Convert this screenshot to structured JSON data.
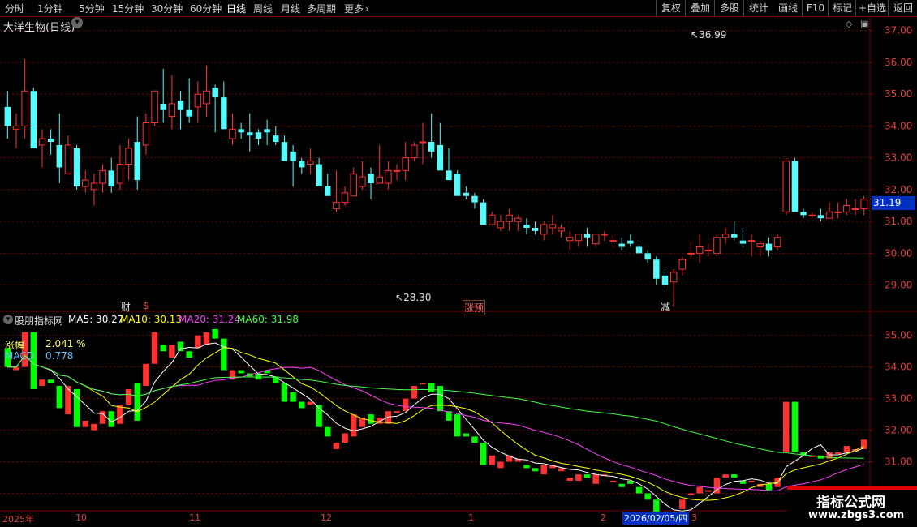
{
  "toolbar": {
    "periods": [
      {
        "label": "分时",
        "active": false
      },
      {
        "label": "1分钟",
        "active": false
      },
      {
        "label": "5分钟",
        "active": false
      },
      {
        "label": "15分钟",
        "active": false
      },
      {
        "label": "30分钟",
        "active": false
      },
      {
        "label": "60分钟",
        "active": false
      },
      {
        "label": "日线",
        "active": true
      },
      {
        "label": "周线",
        "active": false
      },
      {
        "label": "月线",
        "active": false
      },
      {
        "label": "多周期",
        "active": false
      },
      {
        "label": "更多",
        "active": false
      }
    ],
    "right_buttons": [
      "复权",
      "叠加",
      "多股",
      "统计",
      "画线",
      "F10",
      "+自选",
      "返回"
    ],
    "more_icon": "chevron-right-icon"
  },
  "main_chart": {
    "title": "大洋生物(日线)",
    "current_price_badge": "31.19",
    "high_annotation": "36.99",
    "low_annotation": "28.30",
    "event_markers": [
      {
        "label": "财",
        "color": "#e0e0e0"
      },
      {
        "label": "$",
        "color": "#e04040"
      },
      {
        "label": "涨预",
        "color": "#ff6060"
      },
      {
        "label": "减",
        "color": "#e0e0e0"
      }
    ]
  },
  "indicator": {
    "name": "股朋指标网",
    "ma5_label": "MA5: 30.27",
    "ma10_label": "MA10: 30.13",
    "ma20_label": "MA20: 31.24",
    "ma60_label": "MA60: 31.98",
    "zhangfu_label": "涨幅",
    "zhangfu_value": "2.041 %",
    "macd_label": "MACD",
    "macd_value": "0.778"
  },
  "time_axis": {
    "labels": [
      "2025年",
      "10",
      "11",
      "12",
      "1",
      "2",
      "3"
    ],
    "cursor_date": "2026/02/05/四"
  },
  "watermark": {
    "title": "指标公式网",
    "url": "www.zbgs3.com"
  },
  "colors": {
    "up": "#ff3232",
    "down": "#54fcfc",
    "down_lower": "#00ff00",
    "grid": "#7a0000",
    "ma5": "#ffffff",
    "ma10": "#ffff00",
    "ma20": "#ff40ff",
    "ma60": "#40ff40"
  },
  "chart_data": {
    "type": "candlestick",
    "y_axis_main": {
      "min": 29,
      "max": 37,
      "ticks": [
        "37.00",
        "36.00",
        "35.00",
        "34.00",
        "33.00",
        "32.00",
        "31.00",
        "30.00",
        "29.00"
      ]
    },
    "y_axis_lower": {
      "min": 30,
      "max": 35,
      "ticks": [
        "35.00",
        "34.00",
        "33.00",
        "32.00",
        "31.00",
        "30.00"
      ]
    },
    "ohlc": [
      [
        34.6,
        35.1,
        33.6,
        34.0
      ],
      [
        33.9,
        34.4,
        33.3,
        34.0
      ],
      [
        34.0,
        36.1,
        33.6,
        35.1
      ],
      [
        35.1,
        35.2,
        33.3,
        33.3
      ],
      [
        33.4,
        33.9,
        32.7,
        33.6
      ],
      [
        33.6,
        33.9,
        33.1,
        33.5
      ],
      [
        33.4,
        34.4,
        32.2,
        32.7
      ],
      [
        32.5,
        33.7,
        32.5,
        33.4
      ],
      [
        33.3,
        33.4,
        32.0,
        32.1
      ],
      [
        32.1,
        32.6,
        31.9,
        32.3
      ],
      [
        32.0,
        32.5,
        31.5,
        32.2
      ],
      [
        32.2,
        32.8,
        31.9,
        32.6
      ],
      [
        32.6,
        33.0,
        31.9,
        32.1
      ],
      [
        32.2,
        33.4,
        32.0,
        32.8
      ],
      [
        32.8,
        33.6,
        32.3,
        33.3
      ],
      [
        33.5,
        34.3,
        32.0,
        32.3
      ],
      [
        33.4,
        34.4,
        33.1,
        34.1
      ],
      [
        34.1,
        35.1,
        34.0,
        35.1
      ],
      [
        34.7,
        35.8,
        34.1,
        34.5
      ],
      [
        34.3,
        35.6,
        33.9,
        34.7
      ],
      [
        34.8,
        35.1,
        33.9,
        34.5
      ],
      [
        34.5,
        35.5,
        34.1,
        34.3
      ],
      [
        34.6,
        35.4,
        34.1,
        35.0
      ],
      [
        34.7,
        35.9,
        34.3,
        35.1
      ],
      [
        35.2,
        35.3,
        33.8,
        34.9
      ],
      [
        34.9,
        35.4,
        33.9,
        33.9
      ],
      [
        33.6,
        34.4,
        33.4,
        33.9
      ],
      [
        33.9,
        34.1,
        33.6,
        33.8
      ],
      [
        33.8,
        34.4,
        33.2,
        33.7
      ],
      [
        33.8,
        33.9,
        33.4,
        33.6
      ],
      [
        33.9,
        34.2,
        33.4,
        33.8
      ],
      [
        33.7,
        34.0,
        33.4,
        33.5
      ],
      [
        33.5,
        33.7,
        32.9,
        32.9
      ],
      [
        33.2,
        33.4,
        32.1,
        32.9
      ],
      [
        32.9,
        33.0,
        32.5,
        32.7
      ],
      [
        32.8,
        33.3,
        32.5,
        32.9
      ],
      [
        32.8,
        33.0,
        32.1,
        32.1
      ],
      [
        32.1,
        32.5,
        31.8,
        31.8
      ],
      [
        31.4,
        32.6,
        31.3,
        31.6
      ],
      [
        31.6,
        32.1,
        31.5,
        31.9
      ],
      [
        31.8,
        32.7,
        31.8,
        32.5
      ],
      [
        32.1,
        32.9,
        32.0,
        32.4
      ],
      [
        32.5,
        32.7,
        31.7,
        32.2
      ],
      [
        32.2,
        33.4,
        32.2,
        32.4
      ],
      [
        32.2,
        32.9,
        32.0,
        32.6
      ],
      [
        32.6,
        32.8,
        32.3,
        32.6
      ],
      [
        32.6,
        33.5,
        32.3,
        33.0
      ],
      [
        33.0,
        33.5,
        32.9,
        33.4
      ],
      [
        33.5,
        34.1,
        32.8,
        33.5
      ],
      [
        33.5,
        34.4,
        33.0,
        33.2
      ],
      [
        33.4,
        34.1,
        32.7,
        32.6
      ],
      [
        32.6,
        33.3,
        32.3,
        32.3
      ],
      [
        32.5,
        32.6,
        31.9,
        31.8
      ],
      [
        31.9,
        32.1,
        31.7,
        31.8
      ],
      [
        31.8,
        31.9,
        31.4,
        31.6
      ],
      [
        31.6,
        31.7,
        30.9,
        30.9
      ],
      [
        30.9,
        30.9,
        31.3,
        31.2
      ],
      [
        30.8,
        31.2,
        30.7,
        31.0
      ],
      [
        31.0,
        31.4,
        30.7,
        31.2
      ],
      [
        31.0,
        31.2,
        30.7,
        31.1
      ],
      [
        30.9,
        31.1,
        30.6,
        30.8
      ],
      [
        30.8,
        31.0,
        30.6,
        30.7
      ],
      [
        30.6,
        31.0,
        30.4,
        30.9
      ],
      [
        30.8,
        31.2,
        30.6,
        30.9
      ],
      [
        30.7,
        30.9,
        30.5,
        30.8
      ],
      [
        30.4,
        30.7,
        30.1,
        30.5
      ],
      [
        30.4,
        30.6,
        30.2,
        30.6
      ],
      [
        30.6,
        30.8,
        30.2,
        30.5
      ],
      [
        30.3,
        30.6,
        30.2,
        30.6
      ],
      [
        30.6,
        30.7,
        30.4,
        30.6
      ],
      [
        30.4,
        30.6,
        30.2,
        30.4
      ],
      [
        30.3,
        30.5,
        30.1,
        30.2
      ],
      [
        30.4,
        30.6,
        30.2,
        30.3
      ],
      [
        30.2,
        30.3,
        30.0,
        30.0
      ],
      [
        30.0,
        30.1,
        29.7,
        29.8
      ],
      [
        29.8,
        29.9,
        29.0,
        29.2
      ],
      [
        29.3,
        29.5,
        28.9,
        29.0
      ],
      [
        29.1,
        29.5,
        28.3,
        29.4
      ],
      [
        29.5,
        29.9,
        29.3,
        29.8
      ],
      [
        30.0,
        30.4,
        29.8,
        30.0
      ],
      [
        30.0,
        30.6,
        29.7,
        30.2
      ],
      [
        30.1,
        30.3,
        29.9,
        30.1
      ],
      [
        30.0,
        30.6,
        29.9,
        30.5
      ],
      [
        30.5,
        30.8,
        30.3,
        30.6
      ],
      [
        30.6,
        31.0,
        30.4,
        30.5
      ],
      [
        30.4,
        30.8,
        30.2,
        30.3
      ],
      [
        30.4,
        30.6,
        29.9,
        30.4
      ],
      [
        30.2,
        30.4,
        29.9,
        30.3
      ],
      [
        30.3,
        30.5,
        29.9,
        30.1
      ],
      [
        30.2,
        30.6,
        30.1,
        30.5
      ],
      [
        31.3,
        33.0,
        31.2,
        32.9
      ],
      [
        32.9,
        33.0,
        31.3,
        31.3
      ],
      [
        31.3,
        31.4,
        31.1,
        31.2
      ],
      [
        31.2,
        31.3,
        31.1,
        31.2
      ],
      [
        31.2,
        31.4,
        31.0,
        31.1
      ],
      [
        31.1,
        31.6,
        31.1,
        31.3
      ],
      [
        31.3,
        31.6,
        31.1,
        31.3
      ],
      [
        31.3,
        31.7,
        31.2,
        31.5
      ],
      [
        31.4,
        31.7,
        31.2,
        31.4
      ],
      [
        31.4,
        31.8,
        31.2,
        31.7
      ]
    ]
  }
}
